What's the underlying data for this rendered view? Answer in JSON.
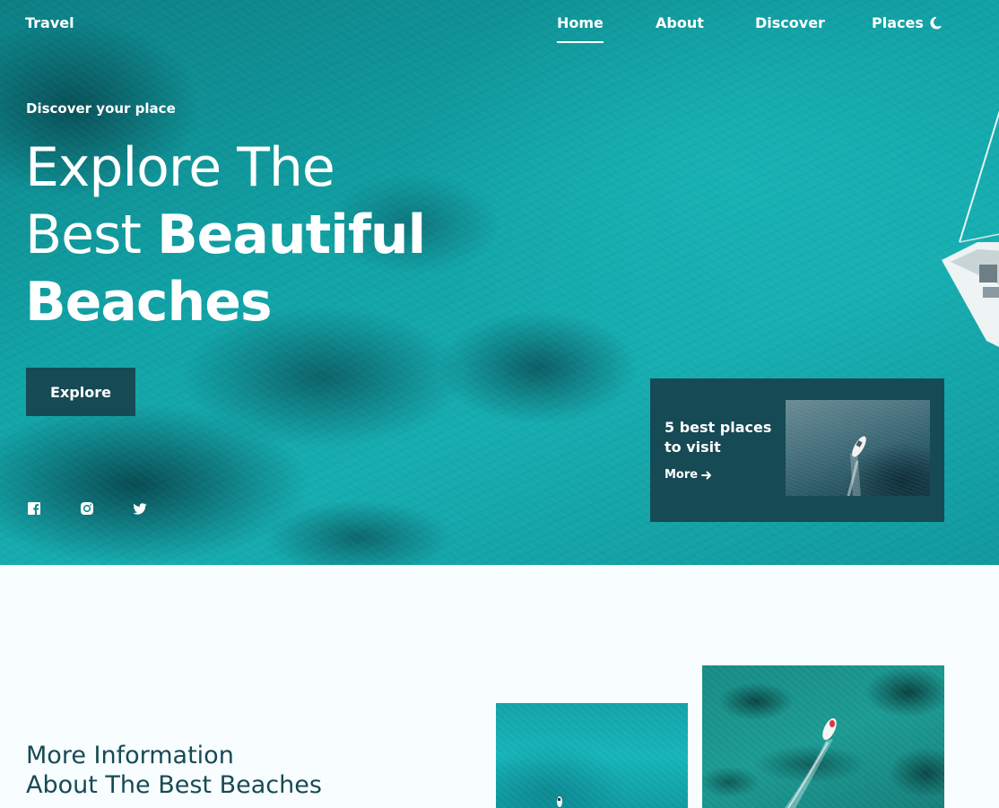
{
  "header": {
    "logo": "Travel",
    "nav": [
      {
        "label": "Home",
        "active": true
      },
      {
        "label": "About",
        "active": false
      },
      {
        "label": "Discover",
        "active": false
      },
      {
        "label": "Places",
        "active": false
      }
    ],
    "theme_toggle_icon": "moon-icon"
  },
  "hero": {
    "subtitle": "Discover your place",
    "title_line1": "Explore The",
    "title_line2_regular": "Best ",
    "title_line2_bold": "Beautiful",
    "title_line3_bold": "Beaches",
    "explore_label": "Explore",
    "social_icons": [
      "facebook-icon",
      "instagram-icon",
      "twitter-icon"
    ]
  },
  "place_card": {
    "title": "5 best places to visit",
    "more_label": "More",
    "more_icon": "arrow-right-icon"
  },
  "info": {
    "title_line1": "More Information",
    "title_line2": "About The Best Beaches"
  },
  "colors": {
    "primary_dark": "#164a55",
    "sea": "#13a7aa",
    "background": "#f8fdff"
  }
}
